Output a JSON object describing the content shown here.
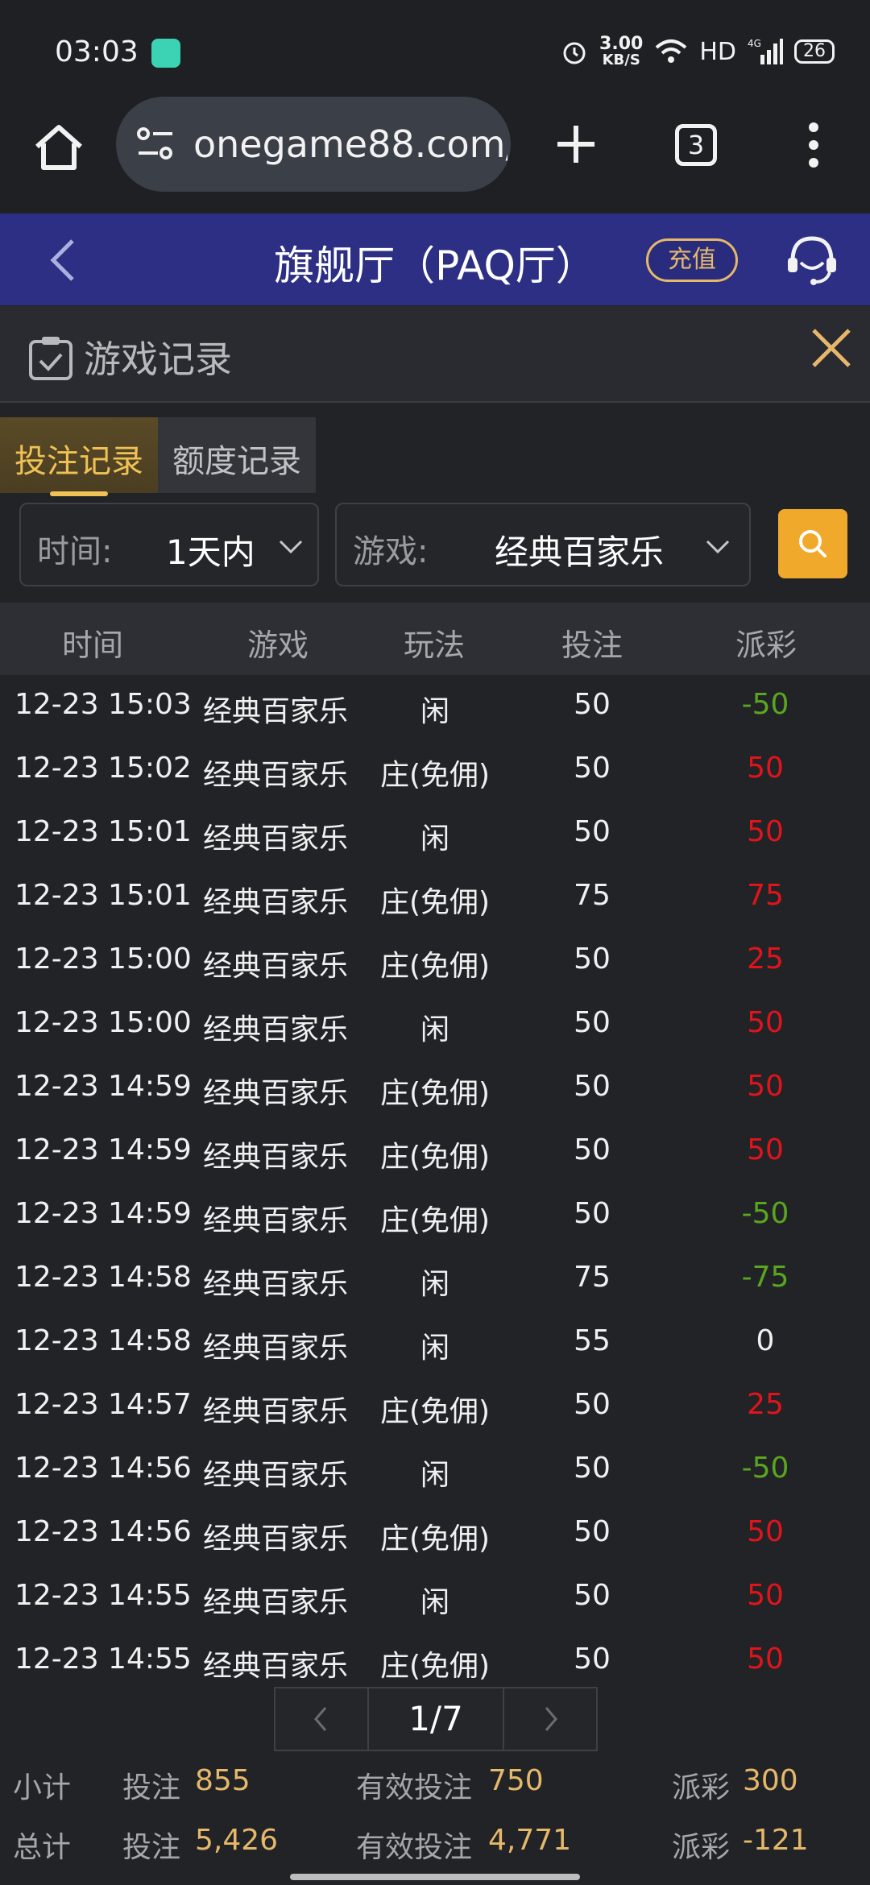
{
  "status_bar": {
    "time": "03:03",
    "net_speed_value": "3.00",
    "net_speed_unit": "KB/S",
    "hd": "HD",
    "network": "4G",
    "battery": "26",
    "icons": [
      "alarm-icon",
      "wifi-icon",
      "signal-icon",
      "battery-icon"
    ]
  },
  "browser": {
    "url": "onegame88.com/",
    "tabs_count": "3"
  },
  "header": {
    "title": "旗舰厅（PAQ厅）",
    "recharge_label": "充值"
  },
  "panel": {
    "title": "游戏记录"
  },
  "tabs": [
    {
      "label": "投注记录",
      "active": true
    },
    {
      "label": "额度记录",
      "active": false
    }
  ],
  "filters": {
    "time_label": "时间:",
    "time_value": "1天内",
    "game_label": "游戏:",
    "game_value": "经典百家乐"
  },
  "table": {
    "headers": [
      "时间",
      "游戏",
      "玩法",
      "投注",
      "派彩"
    ],
    "rows": [
      {
        "time": "12-23 15:03",
        "game": "经典百家乐",
        "play": "闲",
        "bet": "50",
        "payout": "-50"
      },
      {
        "time": "12-23 15:02",
        "game": "经典百家乐",
        "play": "庄(免佣)",
        "bet": "50",
        "payout": "50"
      },
      {
        "time": "12-23 15:01",
        "game": "经典百家乐",
        "play": "闲",
        "bet": "50",
        "payout": "50"
      },
      {
        "time": "12-23 15:01",
        "game": "经典百家乐",
        "play": "庄(免佣)",
        "bet": "75",
        "payout": "75"
      },
      {
        "time": "12-23 15:00",
        "game": "经典百家乐",
        "play": "庄(免佣)",
        "bet": "50",
        "payout": "25"
      },
      {
        "time": "12-23 15:00",
        "game": "经典百家乐",
        "play": "闲",
        "bet": "50",
        "payout": "50"
      },
      {
        "time": "12-23 14:59",
        "game": "经典百家乐",
        "play": "庄(免佣)",
        "bet": "50",
        "payout": "50"
      },
      {
        "time": "12-23 14:59",
        "game": "经典百家乐",
        "play": "庄(免佣)",
        "bet": "50",
        "payout": "50"
      },
      {
        "time": "12-23 14:59",
        "game": "经典百家乐",
        "play": "庄(免佣)",
        "bet": "50",
        "payout": "-50"
      },
      {
        "time": "12-23 14:58",
        "game": "经典百家乐",
        "play": "闲",
        "bet": "75",
        "payout": "-75"
      },
      {
        "time": "12-23 14:58",
        "game": "经典百家乐",
        "play": "闲",
        "bet": "55",
        "payout": "0"
      },
      {
        "time": "12-23 14:57",
        "game": "经典百家乐",
        "play": "庄(免佣)",
        "bet": "50",
        "payout": "25"
      },
      {
        "time": "12-23 14:56",
        "game": "经典百家乐",
        "play": "闲",
        "bet": "50",
        "payout": "-50"
      },
      {
        "time": "12-23 14:56",
        "game": "经典百家乐",
        "play": "庄(免佣)",
        "bet": "50",
        "payout": "50"
      },
      {
        "time": "12-23 14:55",
        "game": "经典百家乐",
        "play": "闲",
        "bet": "50",
        "payout": "50"
      },
      {
        "time": "12-23 14:55",
        "game": "经典百家乐",
        "play": "庄(免佣)",
        "bet": "50",
        "payout": "50"
      }
    ]
  },
  "pager": {
    "page": "1/7"
  },
  "subtotal": {
    "label": "小计",
    "bet_label": "投注",
    "bet_value": "855",
    "valid_label": "有效投注",
    "valid_value": "750",
    "payout_label": "派彩",
    "payout_value": "300"
  },
  "total": {
    "label": "总计",
    "bet_label": "投注",
    "bet_value": "5,426",
    "valid_label": "有效投注",
    "valid_value": "4,771",
    "payout_label": "派彩",
    "payout_value": "-121"
  },
  "colors": {
    "header_bg": "#2c2f83",
    "accent_gold": "#e5b86a",
    "search_bg": "#f0a92a",
    "win_red": "#e0141b",
    "loss_green": "#5aa61e"
  }
}
